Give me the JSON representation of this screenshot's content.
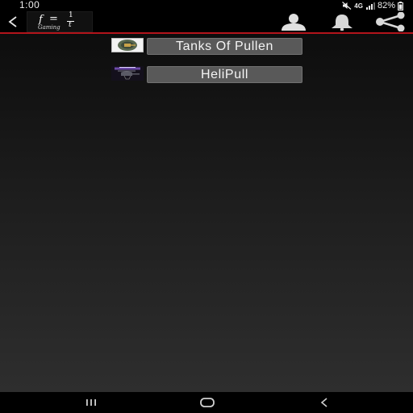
{
  "status_bar": {
    "time": "1:00",
    "network": "4G",
    "battery": "82%"
  },
  "app_bar": {
    "logo": {
      "f": "f",
      "eq": "=",
      "numerator": "1",
      "denominator": "t",
      "subtitle": "Gaming"
    },
    "icons": [
      "back-icon",
      "profile-icon",
      "bell-icon",
      "share-icon"
    ]
  },
  "games": [
    {
      "label": "Tanks Of Pullen",
      "thumb": "tanks-thumbnail"
    },
    {
      "label": "HeliPull",
      "thumb": "helipull-thumbnail"
    }
  ],
  "colors": {
    "accent_line": "#b3141b",
    "button_bg": "#595959",
    "background": "#000000"
  },
  "nav_bar": {
    "icons": [
      "recent-apps-icon",
      "home-icon",
      "back-icon"
    ]
  }
}
